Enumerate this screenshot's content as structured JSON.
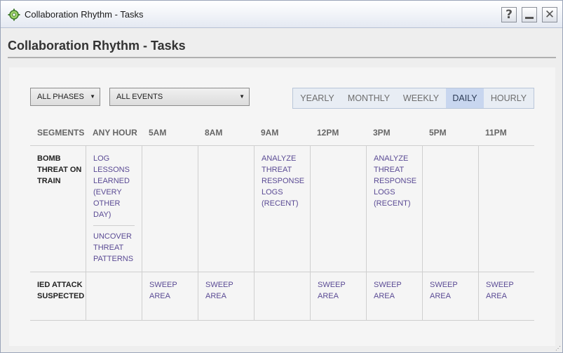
{
  "window": {
    "title": "Collaboration Rhythm - Tasks"
  },
  "controls": {
    "help": "?",
    "close": "✕"
  },
  "heading": "Collaboration Rhythm - Tasks",
  "filters": {
    "phases": "ALL PHASES",
    "events": "ALL EVENTS"
  },
  "tabs": [
    {
      "label": "YEARLY",
      "active": false
    },
    {
      "label": "MONTHLY",
      "active": false
    },
    {
      "label": "WEEKLY",
      "active": false
    },
    {
      "label": "DAILY",
      "active": true
    },
    {
      "label": "HOURLY",
      "active": false
    }
  ],
  "columns": [
    "SEGMENTS",
    "ANY HOUR",
    "5AM",
    "8AM",
    "9AM",
    "12PM",
    "3PM",
    "5PM",
    "11PM"
  ],
  "rows": [
    {
      "segment": "BOMB THREAT ON TRAIN",
      "any_hour": [
        "LOG LESSONS LEARNED (EVERY OTHER DAY)",
        "UNCOVER THREAT PATTERNS"
      ],
      "9am": "ANALYZE THREAT RESPONSE LOGS (RECENT)",
      "3pm": "ANALYZE THREAT RESPONSE LOGS (RECENT)"
    },
    {
      "segment": "IED ATTACK SUSPECTED",
      "5am": "SWEEP AREA",
      "8am": "SWEEP AREA",
      "12pm": "SWEEP AREA",
      "3pm": "SWEEP AREA",
      "5pm": "SWEEP AREA",
      "11pm": "SWEEP AREA"
    }
  ],
  "colors": {
    "accent": "#c8d6ef",
    "task_text": "#5a4a94",
    "panel": "#f5f5f5"
  },
  "icons": {
    "app": "app-icon",
    "help": "help-icon",
    "minimize": "minimize-icon",
    "close": "close-icon"
  }
}
